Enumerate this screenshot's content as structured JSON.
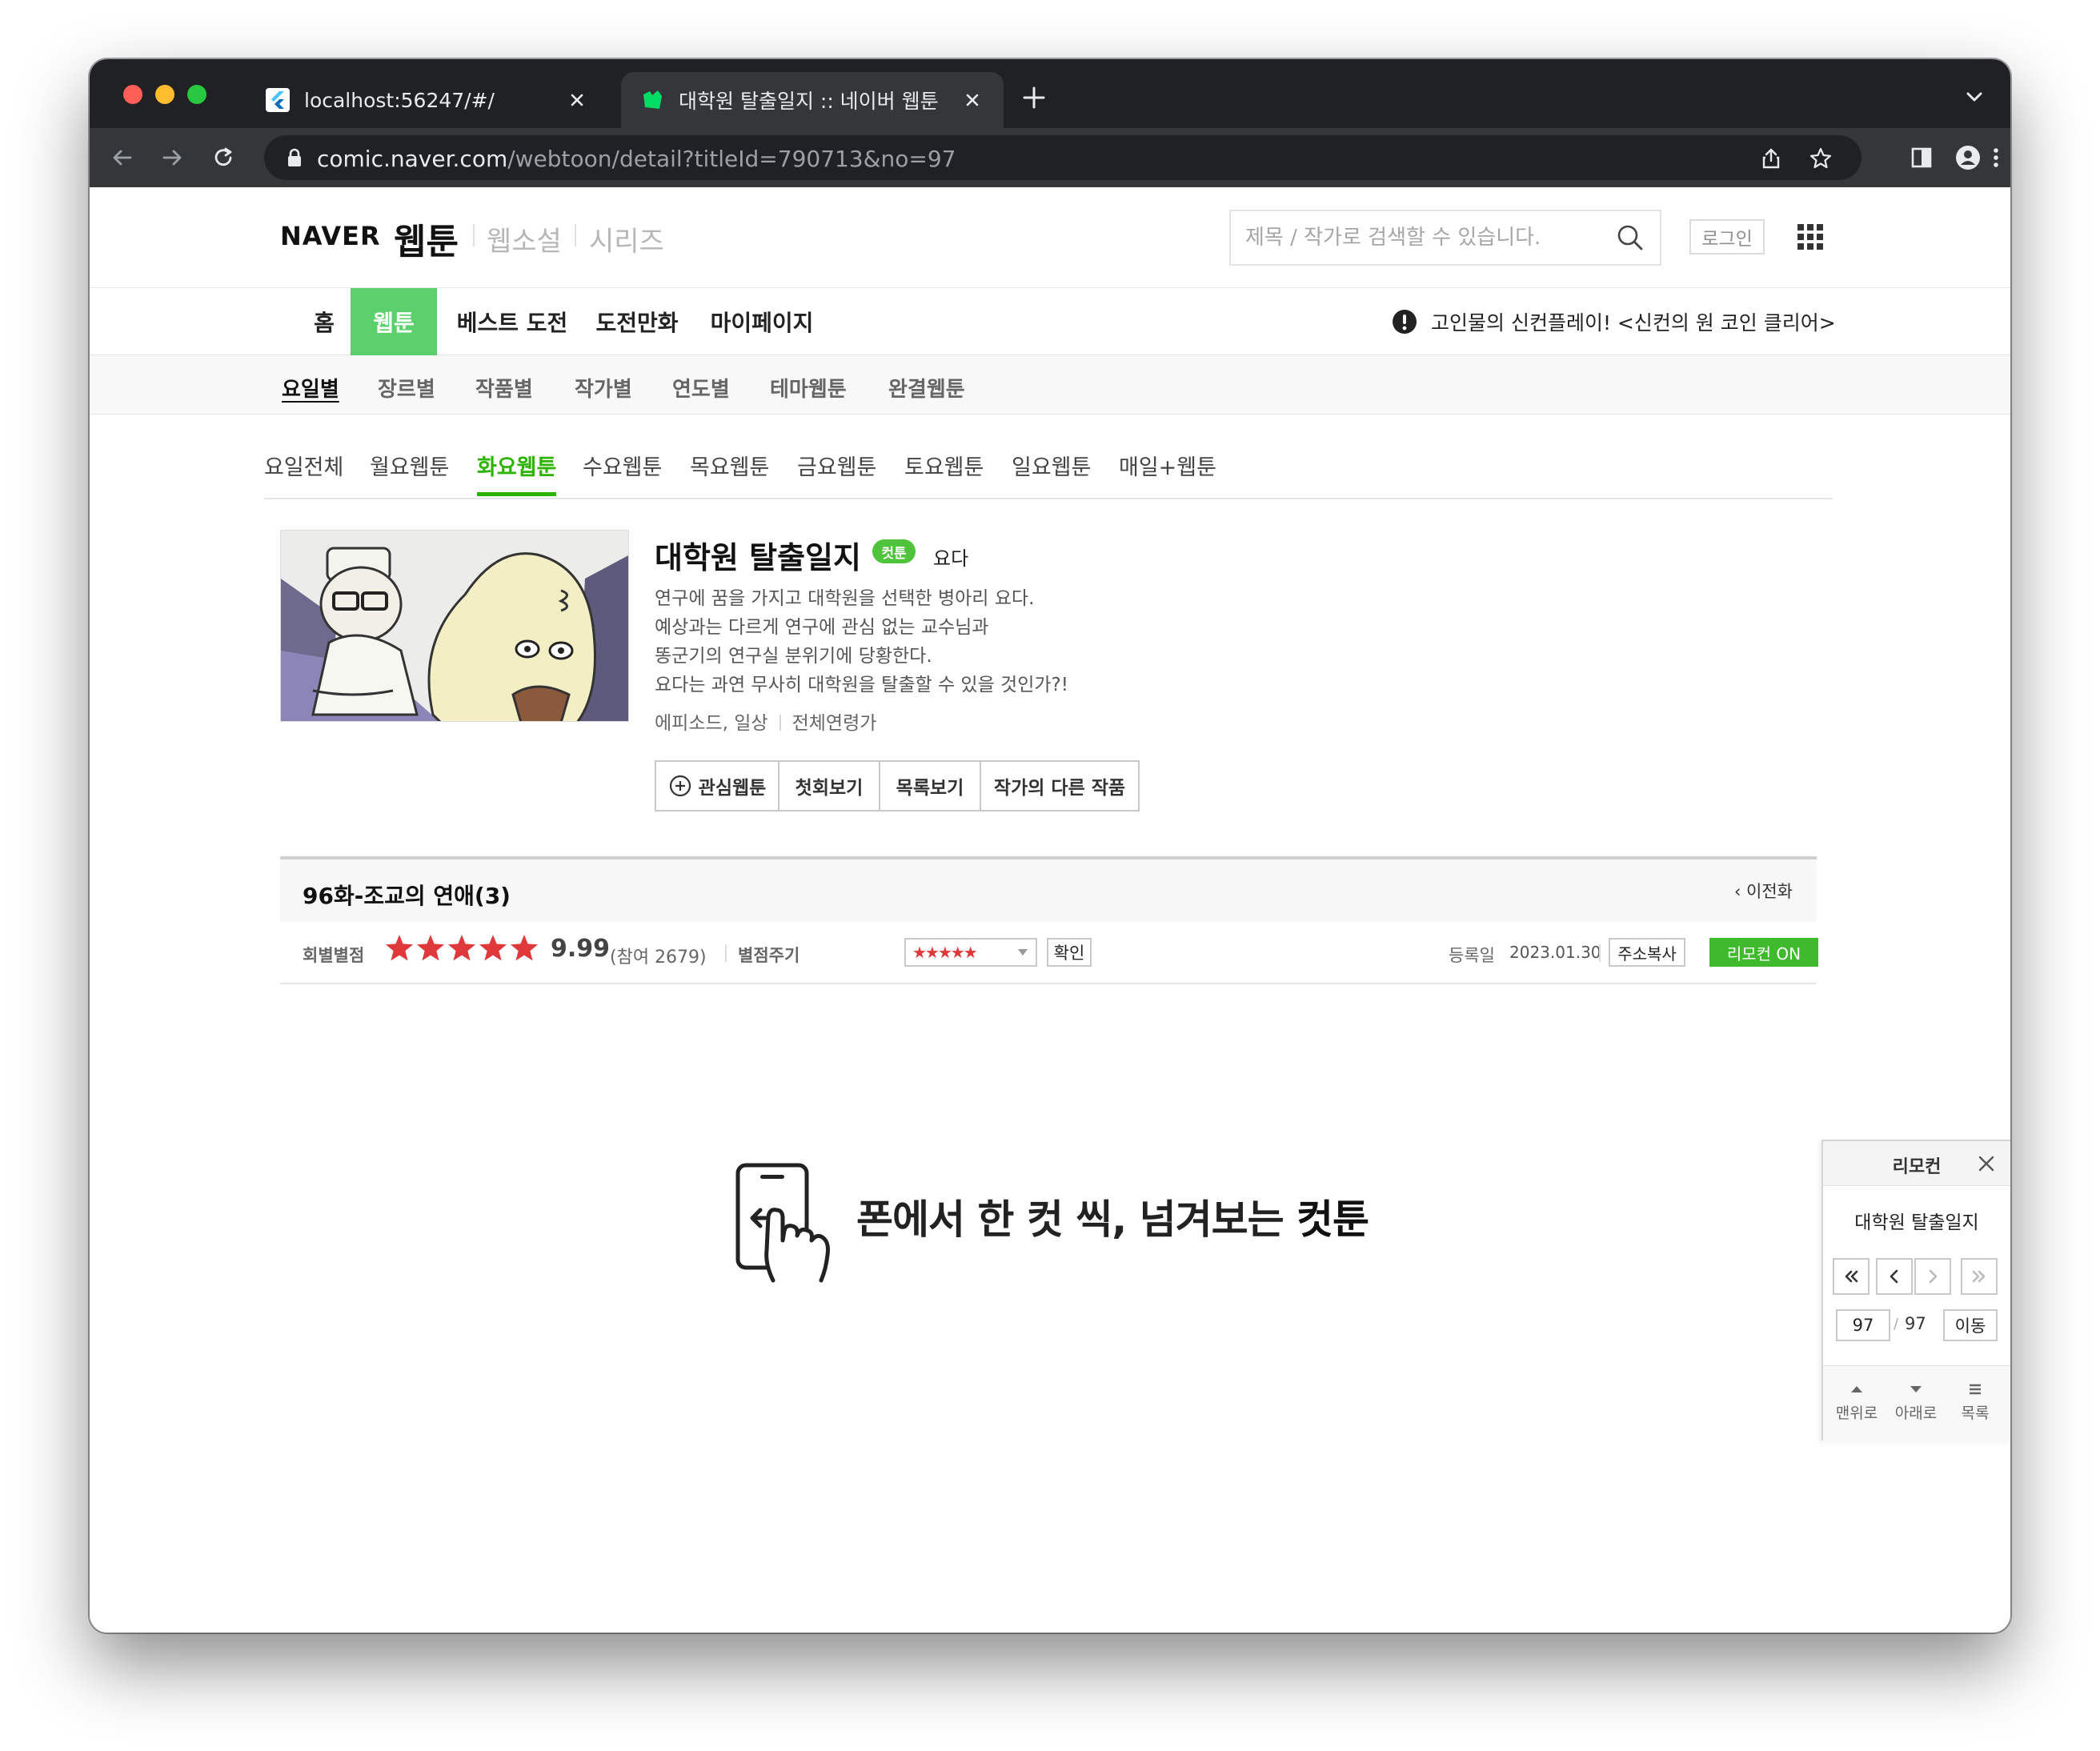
{
  "browser": {
    "tabs": [
      {
        "title": "localhost:56247/#/",
        "favicon": "flutter-icon"
      },
      {
        "title": "대학원 탈출일지 :: 네이버 웹툰",
        "favicon": "naver-webtoon-icon",
        "active": true
      }
    ],
    "url_host": "comic.naver.com",
    "url_path": "/webtoon/detail?titleId=790713&no=97"
  },
  "header": {
    "logo_naver": "NAVER",
    "logo_webtoon": "웹툰",
    "services": [
      "웹소설",
      "시리즈"
    ],
    "search_placeholder": "제목 / 작가로 검색할 수 있습니다.",
    "login": "로그인"
  },
  "lnb": {
    "items": [
      "홈",
      "웹툰",
      "베스트 도전",
      "도전만화",
      "마이페이지"
    ],
    "active": "웹툰",
    "notice": "고인물의 신컨플레이! <신컨의 원 코인 클리어>"
  },
  "snb": {
    "items": [
      "요일별",
      "장르별",
      "작품별",
      "작가별",
      "연도별",
      "테마웹툰",
      "완결웹툰"
    ],
    "active": "요일별"
  },
  "days": {
    "items": [
      "요일전체",
      "월요웹툰",
      "화요웹툰",
      "수요웹툰",
      "목요웹툰",
      "금요웹툰",
      "토요웹툰",
      "일요웹툰",
      "매일+웹툰"
    ],
    "active": "화요웹툰"
  },
  "comic": {
    "title": "대학원 탈출일지",
    "badge": "컷툰",
    "author": "요다",
    "synopsis": [
      "연구에 꿈을 가지고 대학원을 선택한 병아리 요다.",
      "예상과는 다르게 연구에 관심 없는 교수님과",
      "똥군기의 연구실 분위기에 당황한다.",
      "요다는 과연 무사히 대학원을 탈출할 수 있을 것인가?!"
    ],
    "genre": "에피소드, 일상",
    "age": "전체연령가",
    "buttons": {
      "favorite": "관심웹툰",
      "first": "첫회보기",
      "list": "목록보기",
      "other_works": "작가의 다른 작품"
    }
  },
  "episode": {
    "title": "96화-조교의 연애(3)",
    "prev": "이전화",
    "rating_label": "회별별점",
    "rating_stars": 5,
    "score": "9.99",
    "participants": "(참여 2679)",
    "give_label": "별점주기",
    "give_stars": "★★★★★",
    "confirm": "확인",
    "reg_label": "등록일",
    "reg_date": "2023.01.30",
    "copy_url": "주소복사",
    "remote_on": "리모컨 ON"
  },
  "promo": {
    "text_prefix": "폰에서 한 컷 씩, 넘겨보는 ",
    "text_accent": "컷툰"
  },
  "remote": {
    "title": "리모컨",
    "comic_title": "대학원 탈출일지",
    "current_page": "97",
    "total": "97",
    "slash": "/",
    "go": "이동",
    "top": "맨위로",
    "down": "아래로",
    "list": "목록"
  },
  "colors": {
    "naver_green": "#5bd06c",
    "tab_active_green": "#2db400",
    "star_red": "#e0393b",
    "remote_on_green": "#3fba2c"
  }
}
